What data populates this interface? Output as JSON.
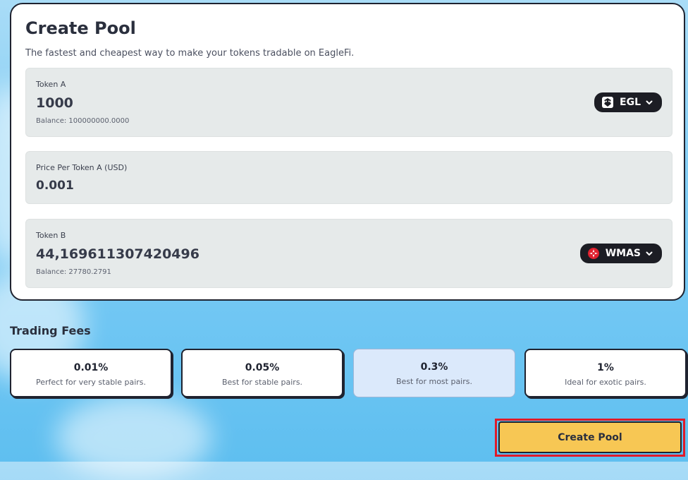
{
  "pool": {
    "title": "Create Pool",
    "subtitle": "The fastest and cheapest way to make your tokens tradable on EagleFi."
  },
  "token_a": {
    "label": "Token A",
    "amount": "1000",
    "balance": "Balance: 100000000.0000",
    "symbol": "EGL",
    "icon": "eagle-token-icon"
  },
  "price": {
    "label": "Price Per Token A (USD)",
    "value": "0.001"
  },
  "token_b": {
    "label": "Token B",
    "amount": "44,169611307420496",
    "balance": "Balance: 27780.2791",
    "symbol": "WMAS",
    "icon": "wmas-token-icon"
  },
  "fees": {
    "title": "Trading Fees",
    "options": [
      {
        "pct": "0.01%",
        "desc": "Perfect for very stable pairs.",
        "selected": false
      },
      {
        "pct": "0.05%",
        "desc": "Best for stable pairs.",
        "selected": false
      },
      {
        "pct": "0.3%",
        "desc": "Best for most pairs.",
        "selected": true
      },
      {
        "pct": "1%",
        "desc": "Ideal for exotic pairs.",
        "selected": false
      }
    ]
  },
  "actions": {
    "create_label": "Create Pool"
  },
  "colors": {
    "accent": "#f7c754",
    "selected_fee": "#dbe9fb",
    "highlight": "#e01b2a",
    "token_button": "#1c1d24"
  }
}
